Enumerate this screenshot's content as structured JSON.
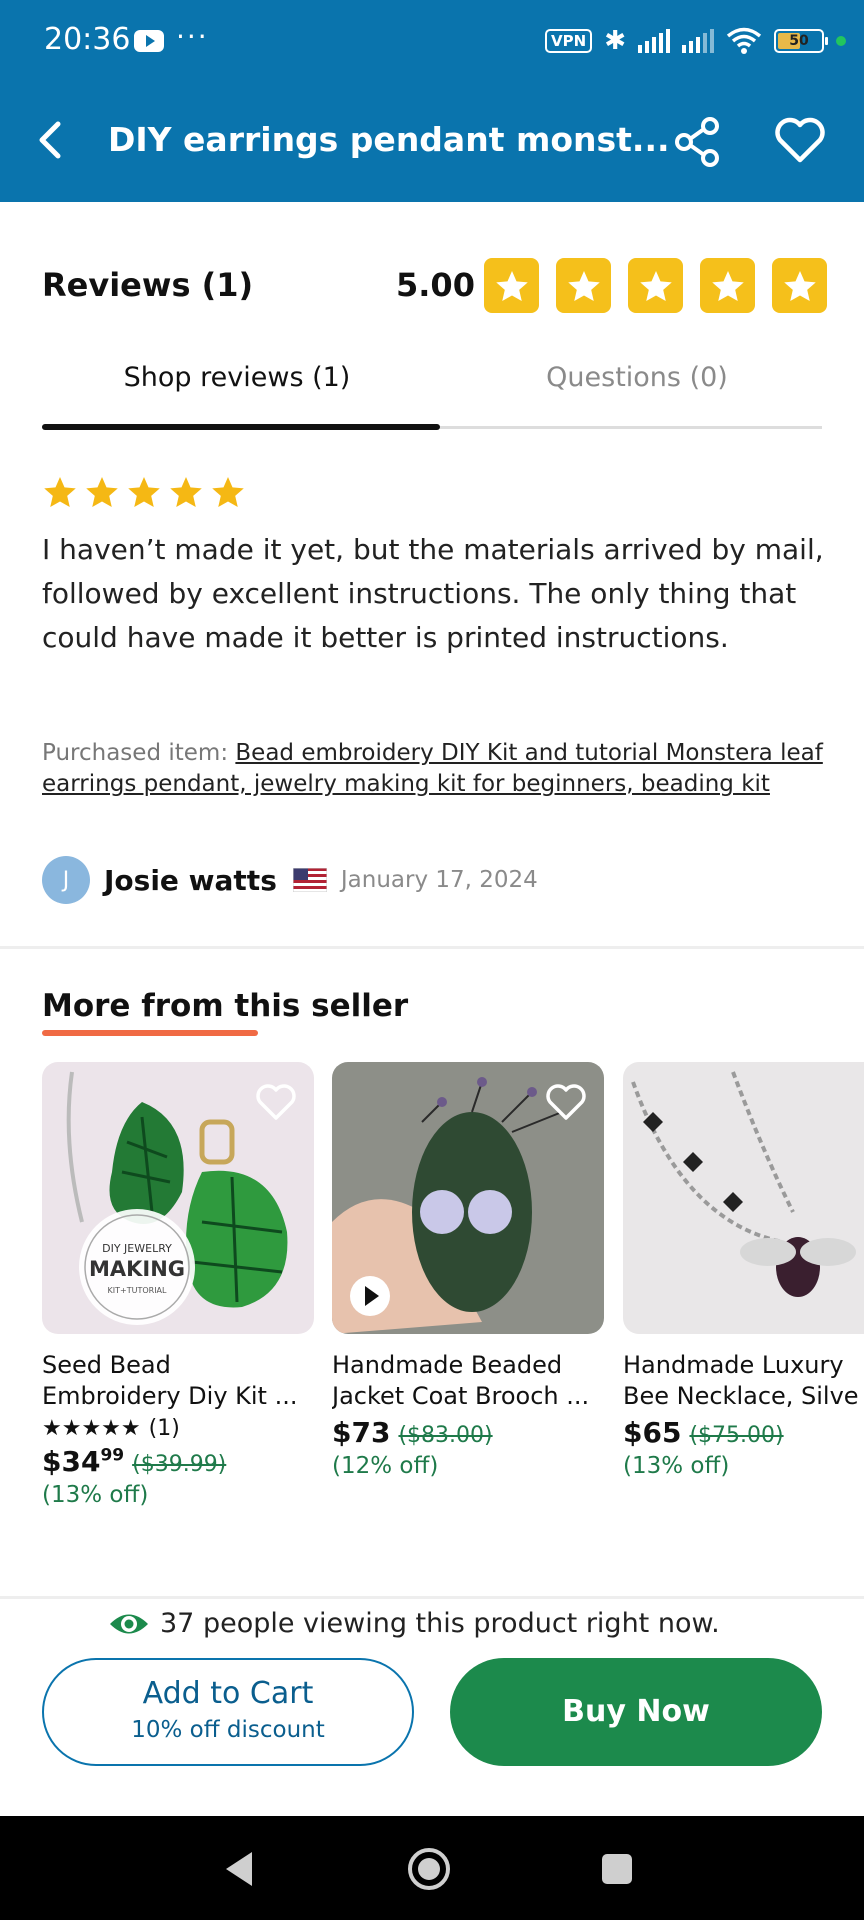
{
  "status_bar": {
    "time": "20:36",
    "dots": "···",
    "vpn": "VPN",
    "battery": "50",
    "icons": [
      "youtube-icon",
      "bluetooth-icon",
      "signal-icon",
      "signal-icon",
      "wifi-icon",
      "battery-icon"
    ]
  },
  "app_bar": {
    "title": "DIY earrings pendant monst...",
    "icons": [
      "back-arrow-icon",
      "share-icon",
      "heart-icon"
    ],
    "color": "#0a74ad"
  },
  "reviews": {
    "title": "Reviews (1)",
    "average": "5.00",
    "star_count": 5,
    "star_color": "#f5c01b",
    "tabs": [
      {
        "label": "Shop reviews (1)",
        "active": true
      },
      {
        "label": "Questions (0)",
        "active": false
      }
    ],
    "review": {
      "stars": 5,
      "text": "I haven’t made it yet, but the materials arrived by mail, followed by excellent instructions. The only thing that could have made it better is printed instructions.",
      "purchased_prefix": "Purchased item: ",
      "purchased_item": "Bead embroidery DIY Kit and tutorial Monstera leaf earrings pendant, jewelry making kit for beginners, beading kit",
      "reviewer_initial": "J",
      "reviewer_name": "Josie watts",
      "date": "January 17, 2024"
    }
  },
  "more_from_seller": {
    "title": "More from this seller",
    "accent": "#f06a44",
    "items": [
      {
        "title": "Seed Bead Embroidery Diy Kit ...",
        "title_line1": "Seed Bead",
        "title_line2": "Embroidery Diy Kit ...",
        "rating_count": "(1)",
        "price_whole": "$34",
        "price_cents": "99",
        "original_price": "($39.99)",
        "discount": "(13% off)",
        "badge_line1": "DIY JEWELRY",
        "badge_line2": "MAKING",
        "badge_line3": "KIT+TUTORIAL"
      },
      {
        "title_line1": "Handmade Beaded",
        "title_line2": "Jacket Coat Brooch ...",
        "price_whole": "$73",
        "original_price": "($83.00)",
        "discount": "(12% off)"
      },
      {
        "title_line1": "Handmade Luxury",
        "title_line2": "Bee Necklace, Silve",
        "price_whole": "$65",
        "original_price": "($75.00)",
        "discount": "(13% off)"
      }
    ]
  },
  "viewing": {
    "text": "37 people viewing this product right now."
  },
  "actions": {
    "add_to_cart": "Add to Cart",
    "add_to_cart_sub": "10% off discount",
    "buy_now": "Buy Now",
    "buy_color": "#1c8a4c"
  }
}
